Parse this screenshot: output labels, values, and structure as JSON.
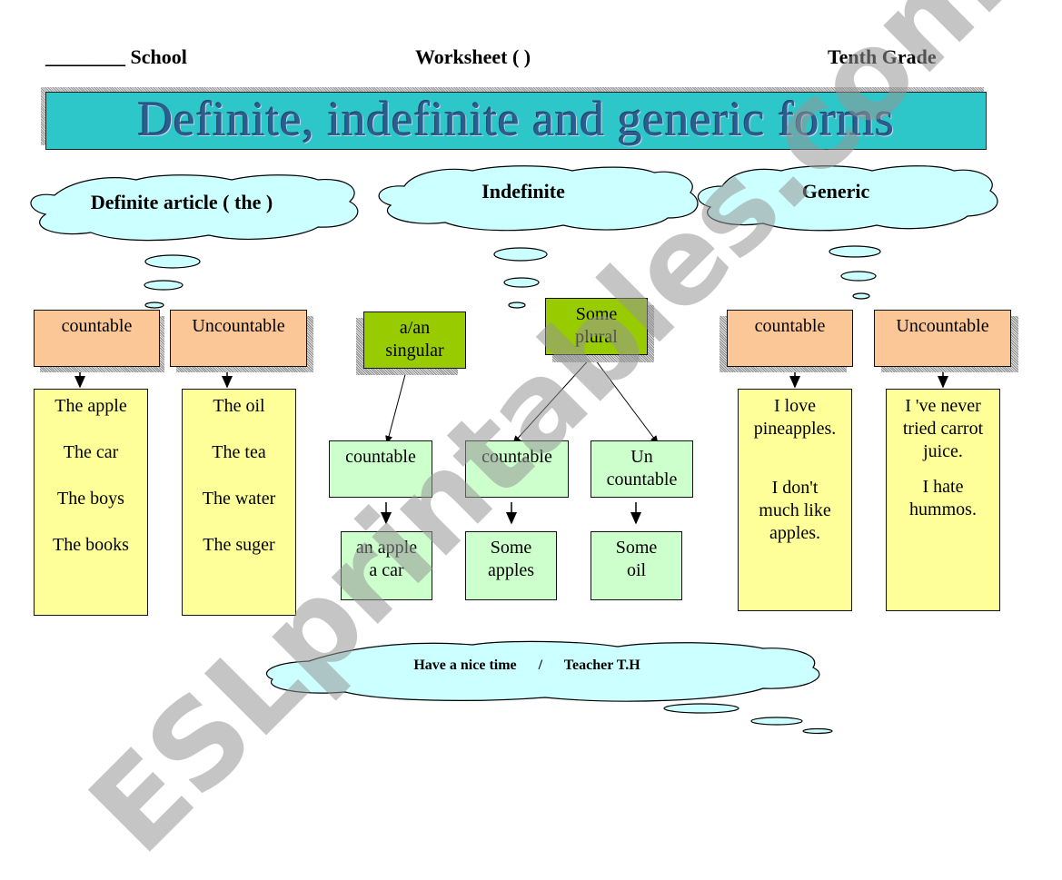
{
  "header": {
    "school_blank": "________",
    "school_label": "School",
    "worksheet_label": "Worksheet (    )",
    "grade_label": "Tenth Grade"
  },
  "title": "Definite, indefinite and generic forms",
  "clouds": {
    "definite": "Definite article ( the )",
    "indefinite": "Indefinite",
    "generic": "Generic",
    "footer": "Have a nice time      /      Teacher T.H"
  },
  "definite": {
    "countable": {
      "label": "countable",
      "examples": [
        "The apple",
        "The car",
        "The boys",
        "The books"
      ]
    },
    "uncountable": {
      "label": "Uncountable",
      "examples": [
        "The oil",
        "The tea",
        "The water",
        "The suger"
      ]
    }
  },
  "indefinite": {
    "a_an": {
      "line1": "a/an",
      "line2": "singular",
      "child_label": "countable",
      "example_line1": "an apple",
      "example_line2": "a car"
    },
    "some": {
      "line1": "Some",
      "line2": "plural",
      "countable": {
        "label": "countable",
        "example_line1": "Some",
        "example_line2": "apples"
      },
      "uncountable": {
        "label_line1": "Un",
        "label_line2": "countable",
        "example_line1": "Some",
        "example_line2": "oil"
      }
    }
  },
  "generic": {
    "countable": {
      "label": "countable",
      "sentence1": [
        "I love",
        "pineapples."
      ],
      "sentence2": [
        "I don't",
        "much like",
        "apples."
      ]
    },
    "uncountable": {
      "label": "Uncountable",
      "sentence1": [
        "I 've never",
        "tried carrot",
        "juice."
      ],
      "sentence2": [
        "I hate",
        "hummos."
      ]
    }
  },
  "watermark": "ESLprintables.com",
  "colors": {
    "title_bg": "#2ec7c9",
    "title_text": "#2c5d8f",
    "cloud": "#ccffff",
    "orange_box": "#fbc796",
    "yellow_box": "#ffff99",
    "light_green_box": "#ccffcc",
    "dark_green_box": "#99cc00"
  }
}
